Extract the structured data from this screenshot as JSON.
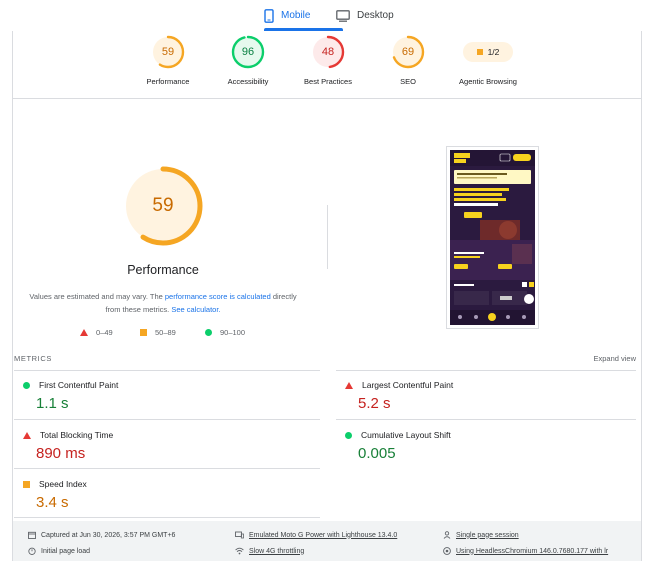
{
  "tabs": {
    "mobile_label": "Mobile",
    "desktop_label": "Desktop",
    "active": "mobile"
  },
  "summary_gauges": [
    {
      "score": "59",
      "label": "Performance",
      "color": "#f5a623",
      "fraction": 0.59,
      "rating": "average"
    },
    {
      "score": "96",
      "label": "Accessibility",
      "color": "#0cce6b",
      "fraction": 0.96,
      "rating": "pass"
    },
    {
      "score": "48",
      "label": "Best Practices",
      "color": "#e53935",
      "fraction": 0.48,
      "rating": "fail"
    },
    {
      "score": "69",
      "label": "SEO",
      "color": "#f5a623",
      "fraction": 0.69,
      "rating": "average"
    }
  ],
  "agentic": {
    "value": "1/2",
    "label": "Agentic Browsing"
  },
  "performance": {
    "score": "59",
    "fraction": 0.59,
    "title": "Performance",
    "note_1": "Values are estimated and may vary. The ",
    "note_link_1": "performance score is calculated",
    "note_2": " directly from these metrics. ",
    "note_link_2": "See calculator."
  },
  "legend": {
    "fail": "0–49",
    "average": "50–89",
    "pass": "90–100"
  },
  "metrics_section": {
    "title": "METRICS",
    "expand_label": "Expand view"
  },
  "metrics": [
    {
      "name": "First Contentful Paint",
      "value": "1.1 s",
      "rating": "pass"
    },
    {
      "name": "Largest Contentful Paint",
      "value": "5.2 s",
      "rating": "fail"
    },
    {
      "name": "Total Blocking Time",
      "value": "890 ms",
      "rating": "fail"
    },
    {
      "name": "Cumulative Layout Shift",
      "value": "0.005",
      "rating": "pass"
    },
    {
      "name": "Speed Index",
      "value": "3.4 s",
      "rating": "average"
    }
  ],
  "footer": {
    "captured": "Captured at Jun 30, 2026, 3:57 PM GMT+6",
    "initial_load": "Initial page load",
    "emulated": "Emulated Moto G Power with Lighthouse 13.4.0",
    "throttling": "Slow 4G throttling",
    "session": "Single page session",
    "browser": "Using HeadlessChromium 146.0.7680.177 with lr"
  },
  "colors": {
    "accent": "#1a73e8",
    "pass": "#0cce6b",
    "average": "#f5a623",
    "fail": "#e53935"
  }
}
